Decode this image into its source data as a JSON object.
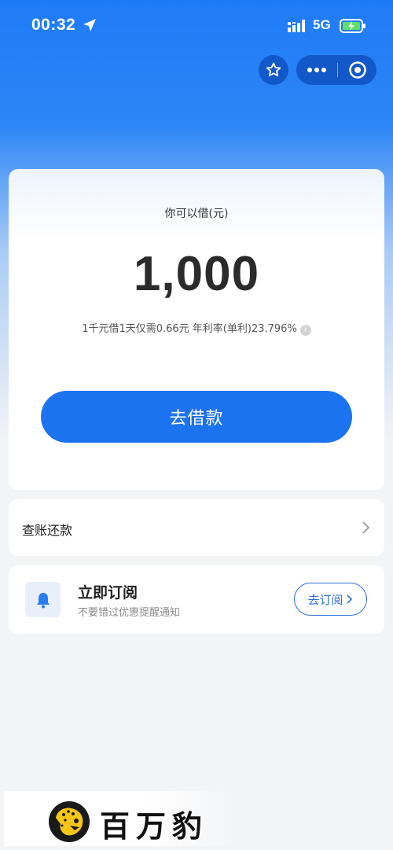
{
  "status_bar": {
    "time": "00:32",
    "network": "5G"
  },
  "header": {
    "favorite_icon": "star-icon",
    "more_icon": "more-dots-icon",
    "close_icon": "target-circle-icon"
  },
  "loan": {
    "label": "你可以借(元)",
    "amount": "1,000",
    "rate_text": "1千元借1天仅需0.66元 年利率(单利)23.796%",
    "info_icon": "i",
    "button_label": "去借款"
  },
  "repay": {
    "label": "查账还款"
  },
  "subscribe": {
    "title": "立即订阅",
    "description": "不要错过优惠提醒通知",
    "button_label": "去订阅"
  },
  "brand": {
    "name": "百万豹"
  },
  "colors": {
    "primary": "#1c73f0",
    "header_blue": "#1e7bf7",
    "page_bg": "#f3f4f6"
  }
}
